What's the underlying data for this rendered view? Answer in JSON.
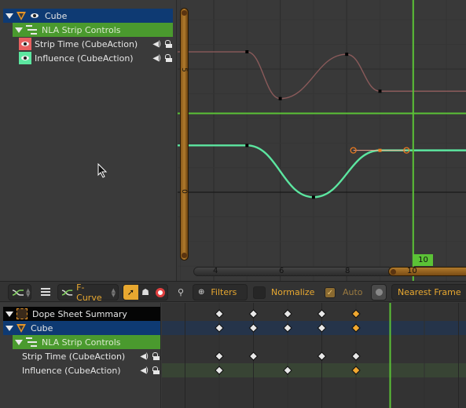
{
  "graph_editor": {
    "channels": [
      {
        "label": "Cube",
        "type": "object",
        "expanded": true
      },
      {
        "label": "NLA Strip Controls",
        "type": "group",
        "expanded": true
      },
      {
        "label": "Strip Time (CubeAction)",
        "type": "fcurve",
        "color": "#e86060"
      },
      {
        "label": "Influence (CubeAction)",
        "type": "fcurve",
        "color": "#5ce6a0"
      }
    ],
    "y_axis_labels": [
      "5",
      "0"
    ],
    "x_axis_labels": [
      "4",
      "6",
      "8",
      "10"
    ],
    "current_frame": "10",
    "curves": {
      "strip_time": {
        "color": "#8a5a5a",
        "keyframes": [
          [
            5,
            5.7
          ],
          [
            6,
            3.8
          ],
          [
            8,
            5.6
          ],
          [
            9,
            4.1
          ]
        ]
      },
      "influence": {
        "color": "#5ce6a0",
        "keyframes": [
          [
            5,
            1.9
          ],
          [
            7,
            -0.2
          ],
          [
            9,
            1.7
          ]
        ],
        "selected_key": [
          9,
          1.7
        ],
        "handles": [
          [
            8.2,
            1.7
          ],
          [
            9.8,
            1.7
          ]
        ]
      }
    },
    "cursor_value": 3.2
  },
  "header": {
    "editor_type_icon": "graph-editor-icon",
    "menu_icon": "hamburger-icon",
    "mode_label": "F-Curve",
    "mode_icon": "fcurve-icon",
    "tool_icons": [
      "select-cursor-icon",
      "ghost-icon",
      "lifebuoy-icon"
    ],
    "search_icon": "magnifier-icon",
    "filters_label": "Filters",
    "normalize_label": "Normalize",
    "normalize_checked": false,
    "auto_label": "Auto",
    "auto_checked": true,
    "snap_label": "Nearest Frame"
  },
  "dopesheet": {
    "channels": [
      {
        "label": "Dope Sheet Summary",
        "type": "summary"
      },
      {
        "label": "Cube",
        "type": "object"
      },
      {
        "label": "NLA Strip Controls",
        "type": "group"
      },
      {
        "label": "Strip Time (CubeAction)",
        "type": "fcurve"
      },
      {
        "label": "Influence (CubeAction)",
        "type": "fcurve"
      }
    ],
    "keyframe_rows": [
      {
        "frames": [
          5,
          6,
          7,
          8,
          9
        ],
        "selected": [
          9
        ]
      },
      {
        "frames": [
          5,
          6,
          7,
          8,
          9
        ],
        "selected": [
          9
        ]
      },
      {
        "frames": [],
        "selected": []
      },
      {
        "frames": [
          5,
          6,
          8,
          9
        ],
        "selected": []
      },
      {
        "frames": [
          5,
          7,
          9
        ],
        "selected": [
          9
        ]
      }
    ],
    "current_frame": 10
  },
  "colors": {
    "playhead": "#5bc236",
    "accent_orange": "#e8a830",
    "selected_key": "#f0a830",
    "key": "#e8e8e8"
  }
}
